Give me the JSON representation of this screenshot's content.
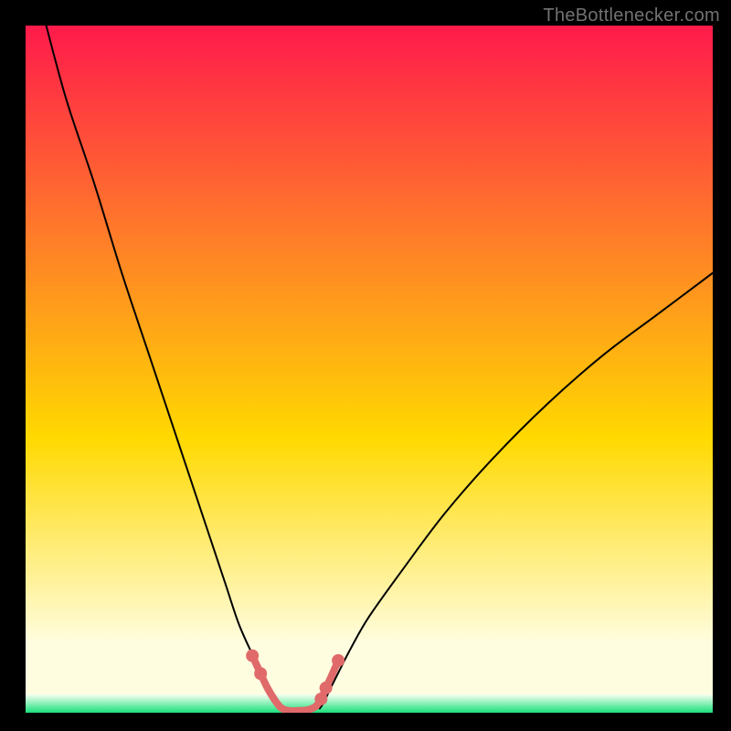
{
  "watermark": "TheBottlenecker.com",
  "chart_data": {
    "type": "line",
    "title": "",
    "xlabel": "",
    "ylabel": "",
    "xlim": [
      0,
      100
    ],
    "ylim": [
      0,
      100
    ],
    "legend": "none",
    "grid": false,
    "background_gradient": {
      "top": "#ff1a4b",
      "mid1": "#ff7a2a",
      "mid2": "#ffd900",
      "yellow_white": "#fffde0",
      "bottom_strip_top": "#f5fff1",
      "bottom_strip_bottom": "#19e07b"
    },
    "series": [
      {
        "name": "left-branch",
        "x": [
          3,
          6,
          10,
          14,
          18,
          22,
          26,
          29,
          31,
          33,
          34.5,
          35.8,
          36.6,
          37.1
        ],
        "y": [
          100,
          89,
          77,
          64,
          52,
          40,
          28,
          19,
          13,
          8.5,
          5.5,
          3.2,
          1.5,
          0.6
        ]
      },
      {
        "name": "right-branch",
        "x": [
          42.8,
          43.4,
          44.3,
          45.6,
          47.4,
          50,
          55,
          61,
          68,
          76,
          84,
          92,
          100
        ],
        "y": [
          0.6,
          1.5,
          3.4,
          6.0,
          9.5,
          14,
          21,
          29,
          37,
          45,
          52,
          58,
          64
        ]
      }
    ],
    "valley_polyline": {
      "name": "valley-highlight",
      "color": "#e06a6a",
      "x": [
        33.0,
        34.2,
        35.2,
        36.3,
        37.2,
        38.3,
        39.7,
        41.0,
        42.2,
        43.0,
        43.7,
        44.5,
        45.5
      ],
      "y": [
        8.3,
        5.7,
        3.6,
        1.8,
        0.7,
        0.3,
        0.3,
        0.4,
        0.9,
        2.0,
        3.6,
        5.3,
        7.6
      ]
    },
    "valley_dots": {
      "name": "valley-dots",
      "color": "#e06a6a",
      "points": [
        {
          "x": 33.0,
          "y": 8.3
        },
        {
          "x": 34.2,
          "y": 5.7
        },
        {
          "x": 43.0,
          "y": 2.0
        },
        {
          "x": 43.7,
          "y": 3.6
        },
        {
          "x": 45.5,
          "y": 7.6
        }
      ]
    }
  }
}
